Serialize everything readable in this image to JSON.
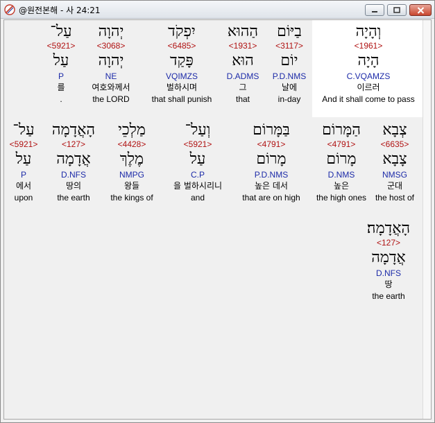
{
  "window": {
    "title": "@원전본해 - 사 24:21",
    "icon": "app-logo-icon",
    "buttons": [
      "minimize-icon",
      "maximize-icon",
      "close-icon"
    ]
  },
  "colors": {
    "strong": "#b01212",
    "parse": "#1c2aa8",
    "highlight": "#ffffff"
  },
  "rows": [
    [
      {
        "heb": "וְהָיָה",
        "strong": "<1961>",
        "lemma": "הָיָה",
        "parse": "C.VQAMZS",
        "ko": "이르러",
        "en": "And it shall come to pass"
      },
      {
        "heb": "בַיּוֹם",
        "strong": "<3117>",
        "lemma": "יוֹם",
        "parse": "P.D.NMS",
        "ko": "날에",
        "en": "in-day"
      },
      {
        "heb": "הַהוּא",
        "strong": "<1931>",
        "lemma": "הוּא",
        "parse": "D.ADMS",
        "ko": "그",
        "en": "that"
      },
      {
        "heb": "יִפְקֹד",
        "strong": "<6485>",
        "lemma": "פָּקַד",
        "parse": "VQIMZS",
        "ko": "벌하시며",
        "en": "that shall punish"
      },
      {
        "heb": "יְהוָה",
        "strong": "<3068>",
        "lemma": "יְהוָה",
        "parse": "NE",
        "ko": "여호와께서",
        "en": "the LORD"
      },
      {
        "heb": "עַל־",
        "strong": "<5921>",
        "lemma": "עַל",
        "parse": "P",
        "ko": "를",
        "en": "."
      }
    ],
    [
      {
        "heb": "צְבָא",
        "strong": "<6635>",
        "lemma": "צָבָא",
        "parse": "NMSG",
        "ko": "군대",
        "en": "the host of"
      },
      {
        "heb": "הַמָּרוֹם",
        "strong": "<4791>",
        "lemma": "מָרוֹם",
        "parse": "D.NMS",
        "ko": "높은",
        "en": "the high ones"
      },
      {
        "heb": "בַּמָּרוֹם",
        "strong": "<4791>",
        "lemma": "מָרוֹם",
        "parse": "P.D.NMS",
        "ko": "높은 데서",
        "en": "that are on high"
      },
      {
        "heb": "וְעַל־",
        "strong": "<5921>",
        "lemma": "עַל",
        "parse": "C.P",
        "ko": "을 벌하시리니",
        "en": "and"
      },
      {
        "heb": "מַלְכֵי",
        "strong": "<4428>",
        "lemma": "מֶלֶךְ",
        "parse": "NMPG",
        "ko": "왕들",
        "en": "the kings of"
      },
      {
        "heb": "הָאֲדָמָה",
        "strong": "<127>",
        "lemma": "אֲדָמָה",
        "parse": "D.NFS",
        "ko": "땅의",
        "en": "the earth"
      },
      {
        "heb": "עַל־",
        "strong": "<5921>",
        "lemma": "עַל",
        "parse": "P",
        "ko": "에서",
        "en": "upon"
      }
    ],
    [
      {
        "heb": "הָאֲדָמָה׃",
        "strong": "<127>",
        "lemma": "אֲדָמָה",
        "parse": "D.NFS",
        "ko": "땅",
        "en": "the earth"
      }
    ]
  ]
}
